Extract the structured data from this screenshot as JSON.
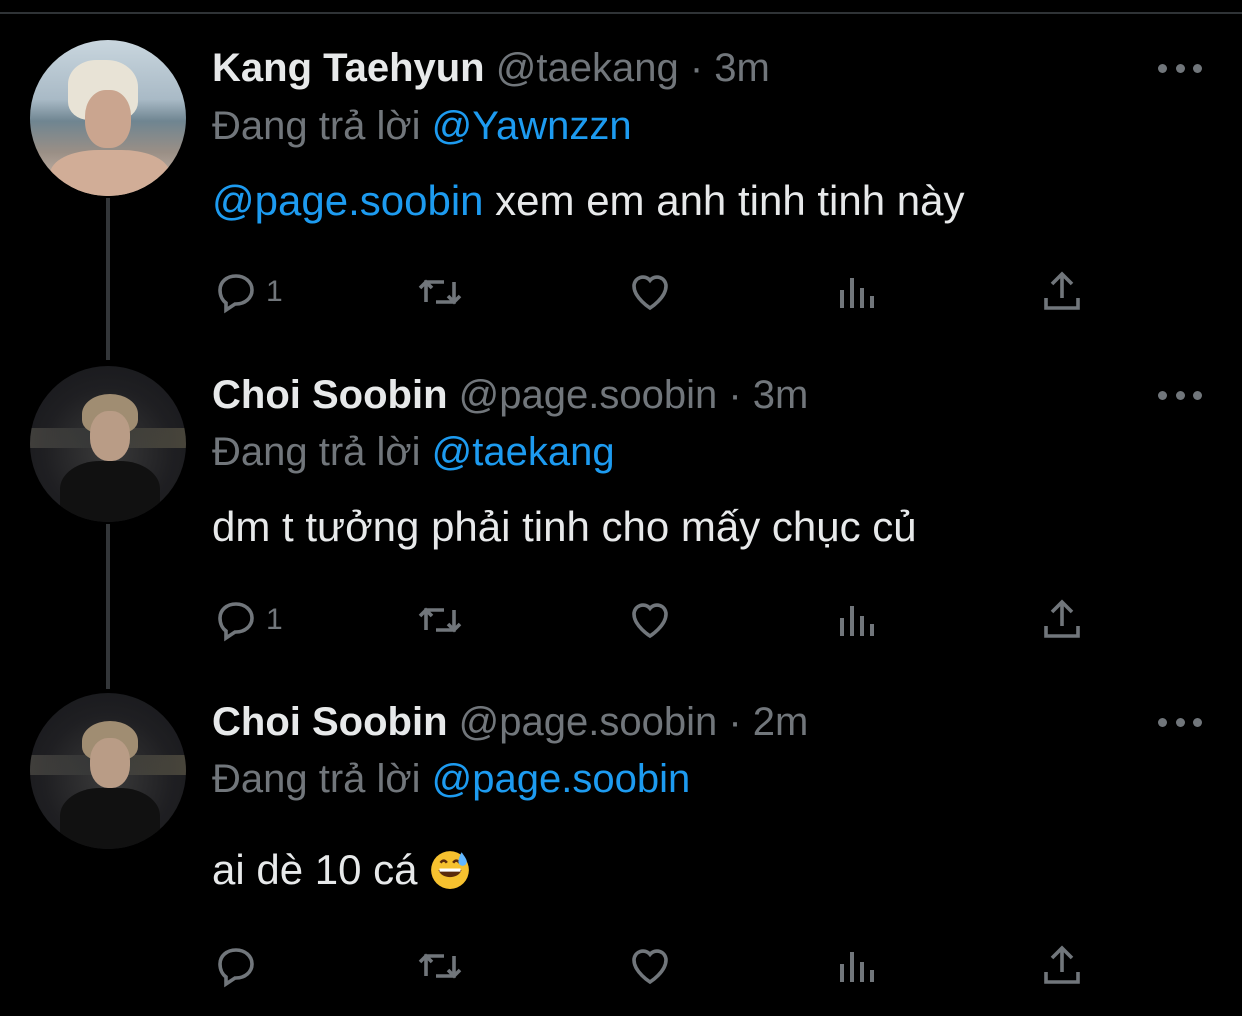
{
  "tweets": [
    {
      "name": "Kang Taehyun",
      "handle": "@taekang",
      "sep": "·",
      "time": "3m",
      "reply_prefix": "Đang trả lời",
      "reply_to": "@Yawnzzn",
      "mention": "@page.soobin",
      "text": " xem em anh tinh tinh này",
      "reply_count": "1"
    },
    {
      "name": "Choi Soobin",
      "handle": "@page.soobin",
      "sep": "·",
      "time": "3m",
      "reply_prefix": "Đang trả lời",
      "reply_to": "@taekang",
      "text": "dm t tưởng phải tinh cho mấy chục củ",
      "reply_count": "1"
    },
    {
      "name": "Choi Soobin",
      "handle": "@page.soobin",
      "sep": "·",
      "time": "2m",
      "reply_prefix": "Đang trả lời",
      "reply_to": "@page.soobin",
      "text": "ai dè 10 cá ",
      "emoji": "grinning-face-with-sweat",
      "reply_count": ""
    }
  ],
  "icons": {
    "reply": "reply-icon",
    "retweet": "retweet-icon",
    "like": "heart-icon",
    "views": "views-icon",
    "share": "share-icon",
    "more": "more-icon"
  },
  "colors": {
    "background": "#000000",
    "text": "#e7e9ea",
    "muted": "#71767b",
    "accent": "#1d9bf0",
    "thread_line": "#333639"
  }
}
